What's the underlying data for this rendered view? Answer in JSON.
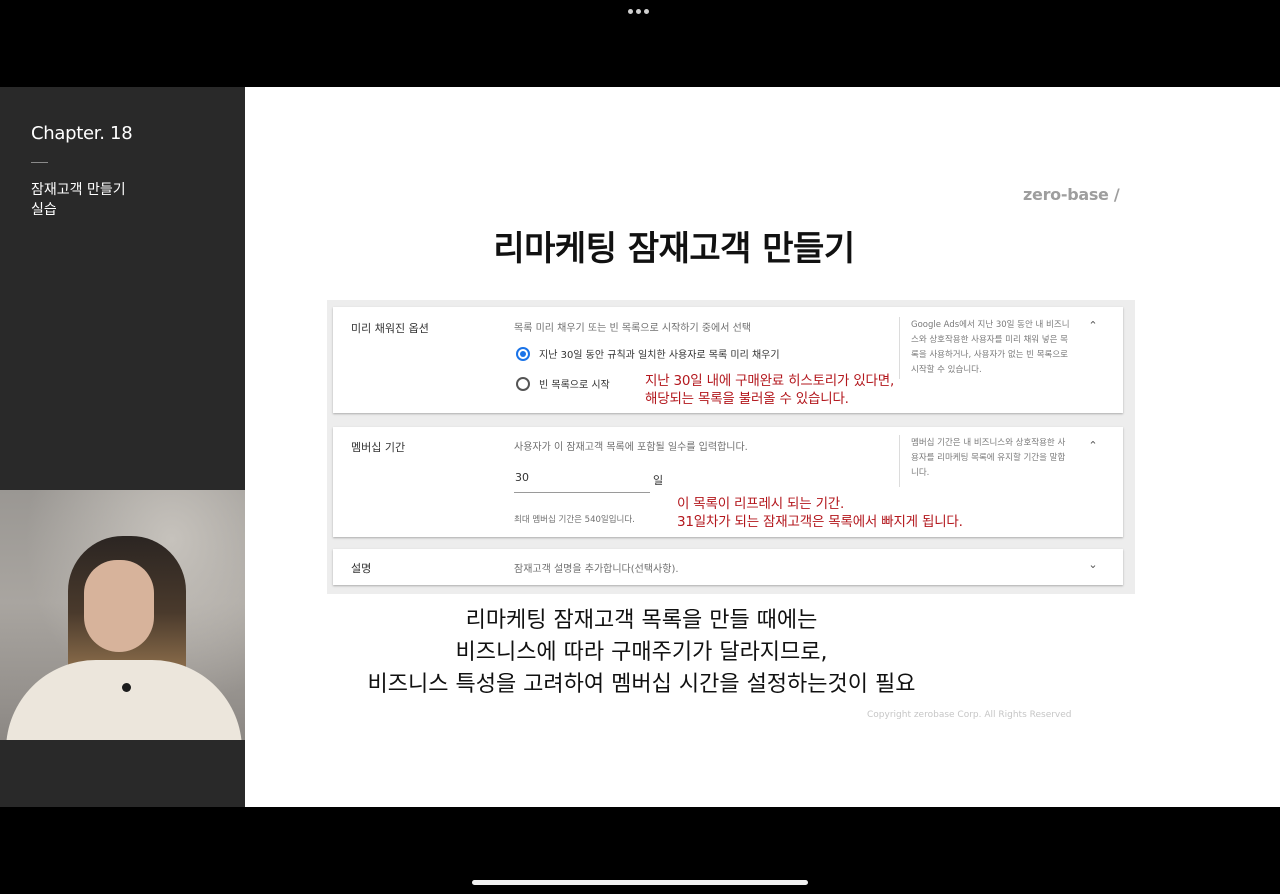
{
  "lecture": {
    "chapter": "Chapter. 18",
    "topic": "잠재고객 만들기\n실습"
  },
  "slide": {
    "logo": "zero-base /",
    "title": "리마케팅 잠재고객 만들기",
    "sections": [
      {
        "label": "미리 채워진 옵션",
        "description": "목록 미리 채우기 또는 빈 목록으로 시작하기 중에서 선택",
        "options": [
          {
            "label": "지난 30일 동안 규칙과 일치한 사용자로 목록 미리 채우기",
            "selected": true
          },
          {
            "label": "빈 목록으로 시작",
            "selected": false
          }
        ],
        "help": "Google Ads에서 지난 30일 동안 내 비즈니스와 상호작용한 사용자를 미리 채워 넣은 목록을 사용하거나, 사용자가 없는 빈 목록으로 시작할 수 있습니다.",
        "toggle_icon": "chevron-up-icon"
      },
      {
        "label": "멤버십 기간",
        "description": "사용자가 이 잠재고객 목록에 포함될 일수를 입력합니다.",
        "days_value": "30",
        "days_unit": "일",
        "max_note": "최대 멤버십 기간은 540일입니다.",
        "help": "멤버십 기간은 내 비즈니스와 상호작용한 사용자를 리마케팅 목록에 유지할 기간을 말합니다.",
        "toggle_icon": "chevron-up-icon"
      },
      {
        "label": "설명",
        "description": "잠재고객 설명을 추가합니다(선택사항).",
        "toggle_icon": "chevron-down-icon"
      }
    ],
    "annotations": {
      "prefill": "지난 30일 내에 구매완료 히스토리가 있다면,\n해당되는 목록을 불러올 수 있습니다.",
      "membership": "이 목록이 리프레시 되는 기간.\n31일차가 되는 잠재고객은 목록에서 빠지게 됩니다."
    },
    "caption": "리마케팅 잠재고객 목록을 만들 때에는\n비즈니스에 따라 구매주기가 달라지므로,\n비즈니스 특성을 고려하여 멤버십 시간을 설정하는것이 필요",
    "copyright": "Copyright zerobase Corp. All Rights Reserved"
  },
  "colors": {
    "annotation_red": "#b3171d",
    "radio_blue": "#1a73e8",
    "sidebar_bg": "#292929"
  }
}
